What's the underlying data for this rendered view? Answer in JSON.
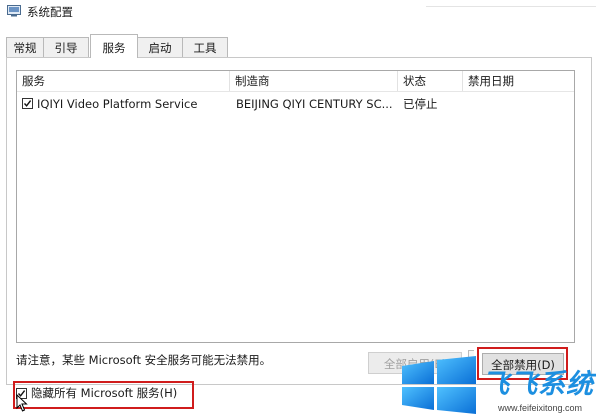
{
  "window": {
    "title": "系统配置"
  },
  "tabs": [
    {
      "label": "常规"
    },
    {
      "label": "引导"
    },
    {
      "label": "服务",
      "active": true
    },
    {
      "label": "启动"
    },
    {
      "label": "工具"
    }
  ],
  "table": {
    "columns": [
      "服务",
      "制造商",
      "状态",
      "禁用日期"
    ],
    "rows": [
      {
        "checked": true,
        "service": "IQIYI Video Platform Service",
        "manufacturer": "BEIJING QIYI CENTURY SC...",
        "status": "已停止",
        "disabled_date": ""
      }
    ]
  },
  "footer": {
    "note": "请注意，某些 Microsoft 安全服务可能无法禁用。",
    "enable_all_label": "全部启用(E)",
    "disable_all_label": "全部禁用(D)",
    "hide_ms_label": "隐藏所有 Microsoft 服务(H)",
    "hide_ms_checked": true
  },
  "watermark": {
    "brand": "飞飞系统",
    "url": "www.feifeixitong.com"
  },
  "colors": {
    "highlight": "#d01c1c",
    "watermark_blue": "#1c8fe0"
  }
}
